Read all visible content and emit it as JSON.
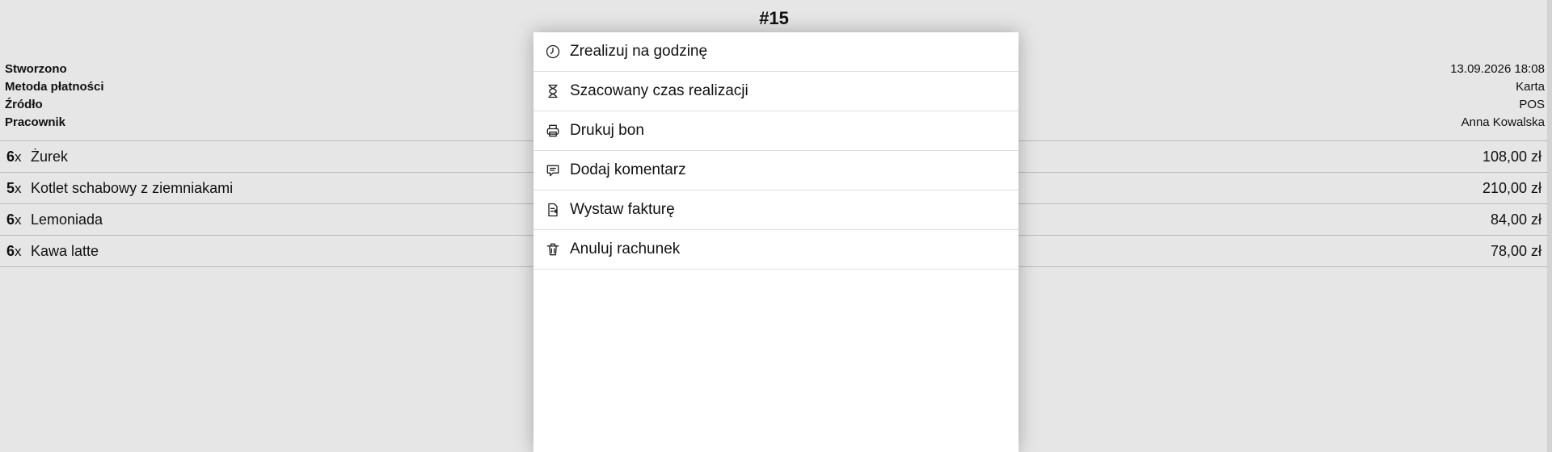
{
  "order": {
    "title": "#15"
  },
  "meta": {
    "created_label": "Stworzono",
    "created_value": "13.09.2026 18:08",
    "payment_label": "Metoda płatności",
    "payment_value": "Karta",
    "source_label": "Źródło",
    "source_value": "POS",
    "employee_label": "Pracownik",
    "employee_value": "Anna Kowalska"
  },
  "items": [
    {
      "qty": "6",
      "x": "x",
      "name": "Żurek",
      "price": "108,00 zł"
    },
    {
      "qty": "5",
      "x": "x",
      "name": "Kotlet schabowy z ziemniakami",
      "price": "210,00 zł"
    },
    {
      "qty": "6",
      "x": "x",
      "name": "Lemoniada",
      "price": "84,00 zł"
    },
    {
      "qty": "6",
      "x": "x",
      "name": "Kawa latte",
      "price": "78,00 zł"
    }
  ],
  "menu": {
    "items": [
      {
        "label": "Zrealizuj na godzinę",
        "icon": "clock-icon"
      },
      {
        "label": "Szacowany czas realizacji",
        "icon": "hourglass-icon"
      },
      {
        "label": "Drukuj bon",
        "icon": "printer-icon"
      },
      {
        "label": "Dodaj komentarz",
        "icon": "comment-icon"
      },
      {
        "label": "Wystaw fakturę",
        "icon": "invoice-icon"
      },
      {
        "label": "Anuluj rachunek",
        "icon": "trash-icon"
      }
    ]
  }
}
